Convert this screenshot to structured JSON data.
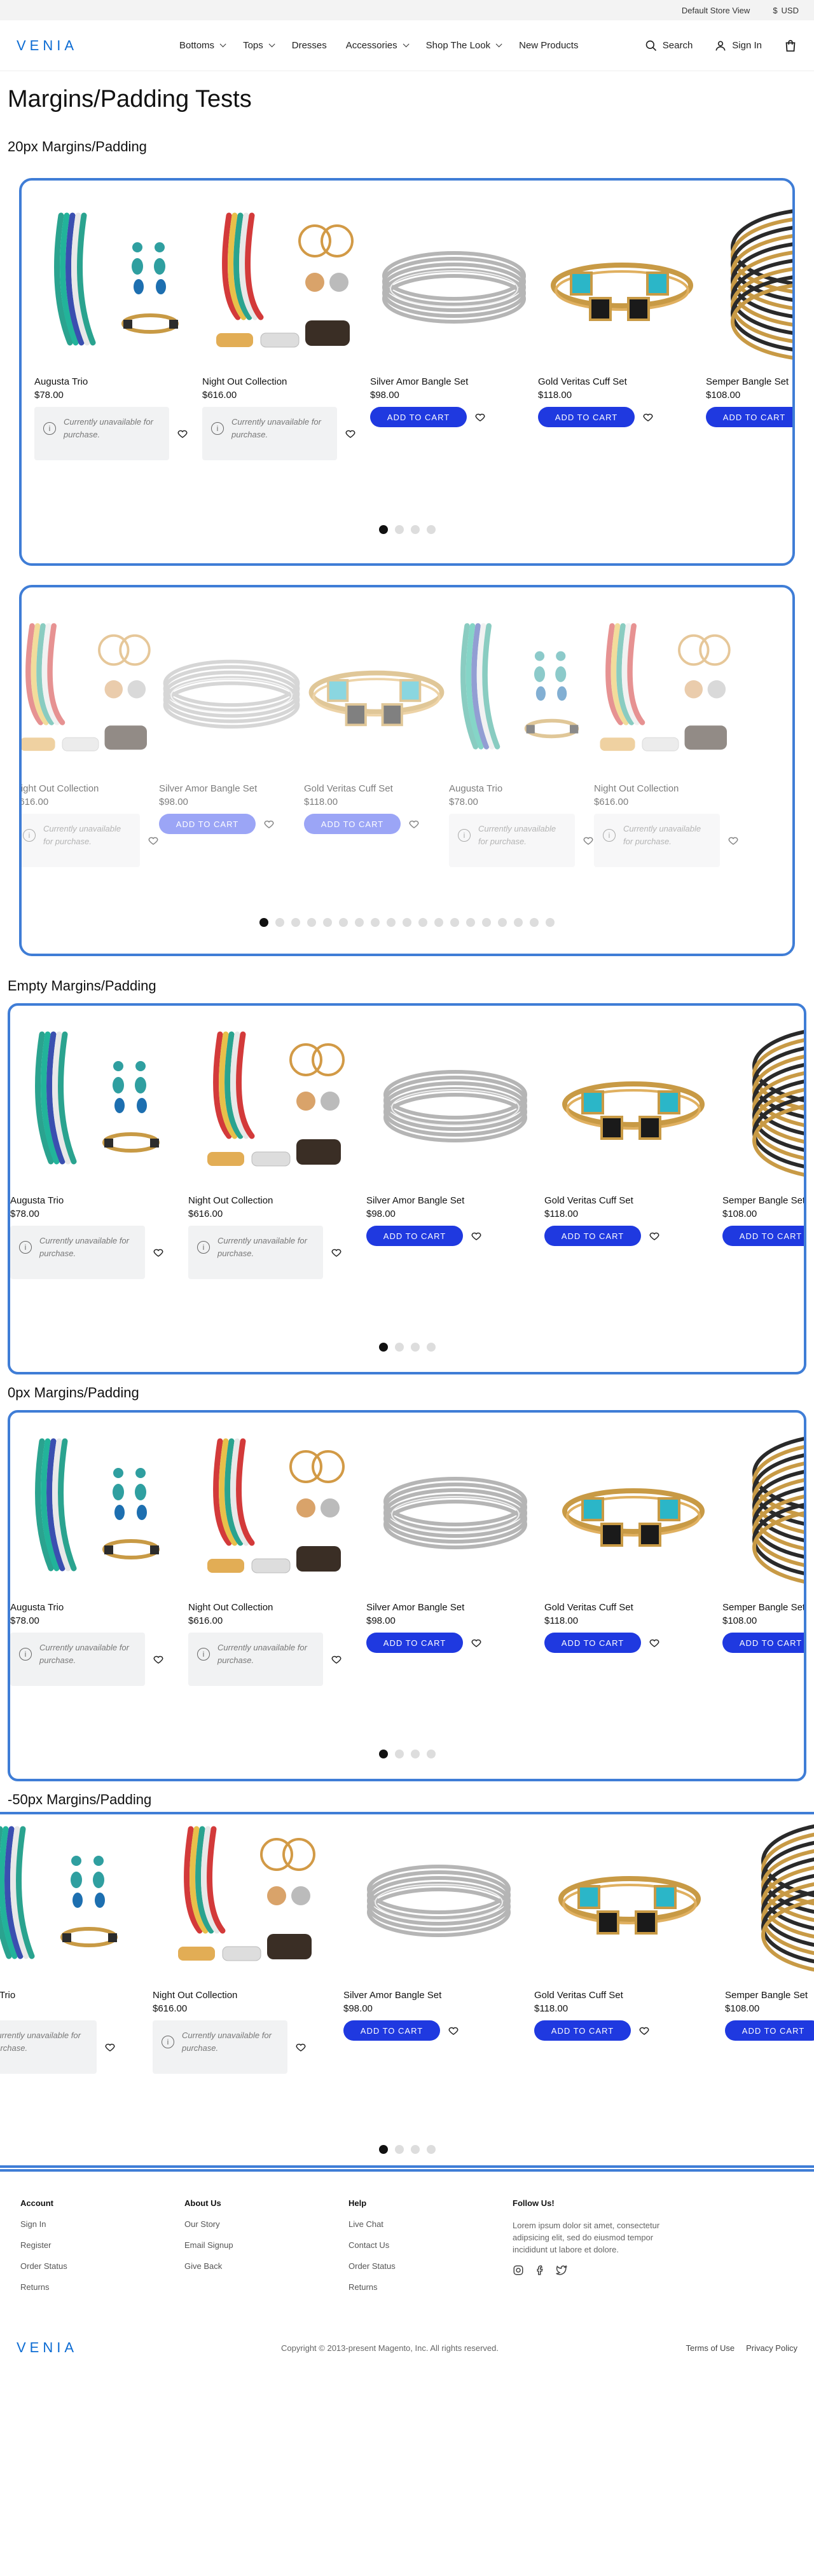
{
  "topbar": {
    "store": "Default Store View",
    "currency_symbol": "$",
    "currency": "USD"
  },
  "header": {
    "logo": "VENIA",
    "nav": [
      {
        "label": "Bottoms",
        "has_menu": true
      },
      {
        "label": "Tops",
        "has_menu": true
      },
      {
        "label": "Dresses",
        "has_menu": false
      },
      {
        "label": "Accessories",
        "has_menu": true
      },
      {
        "label": "Shop The Look",
        "has_menu": true
      },
      {
        "label": "New Products",
        "has_menu": false
      }
    ],
    "search": "Search",
    "signin": "Sign In"
  },
  "page_title": "Margins/Padding Tests",
  "sections": [
    {
      "title": "20px Margins/Padding"
    },
    {
      "title": "Empty Margins/Padding"
    },
    {
      "title": "0px Margins/Padding"
    },
    {
      "title": "-50px Margins/Padding"
    }
  ],
  "products": [
    {
      "name": "Augusta Trio",
      "price": "$78.00",
      "available": false
    },
    {
      "name": "Night Out Collection",
      "price": "$616.00",
      "available": false
    },
    {
      "name": "Silver Amor Bangle Set",
      "price": "$98.00",
      "available": true
    },
    {
      "name": "Gold Veritas Cuff Set",
      "price": "$118.00",
      "available": true
    },
    {
      "name": "Semper Bangle Set",
      "price": "$108.00",
      "available": true
    }
  ],
  "unavailable_text": "Currently unavailable for purchase.",
  "add_to_cart": "ADD TO CART",
  "colors": {
    "accent": "#3f7dd6",
    "button": "#1f39e0",
    "logo": "#1b2b57"
  },
  "footer": {
    "columns": [
      {
        "heading": "Account",
        "links": [
          "Sign In",
          "Register",
          "Order Status",
          "Returns"
        ]
      },
      {
        "heading": "About Us",
        "links": [
          "Our Story",
          "Email Signup",
          "Give Back"
        ]
      },
      {
        "heading": "Help",
        "links": [
          "Live Chat",
          "Contact Us",
          "Order Status",
          "Returns"
        ]
      }
    ],
    "follow": {
      "heading": "Follow Us!",
      "text": "Lorem ipsum dolor sit amet, consectetur adipsicing elit, sed do eiusmod tempor incididunt ut labore et dolore."
    },
    "logo": "VENIA",
    "copyright": "Copyright © 2013-present Magento, Inc. All rights reserved.",
    "terms": "Terms of Use",
    "privacy": "Privacy Policy"
  }
}
